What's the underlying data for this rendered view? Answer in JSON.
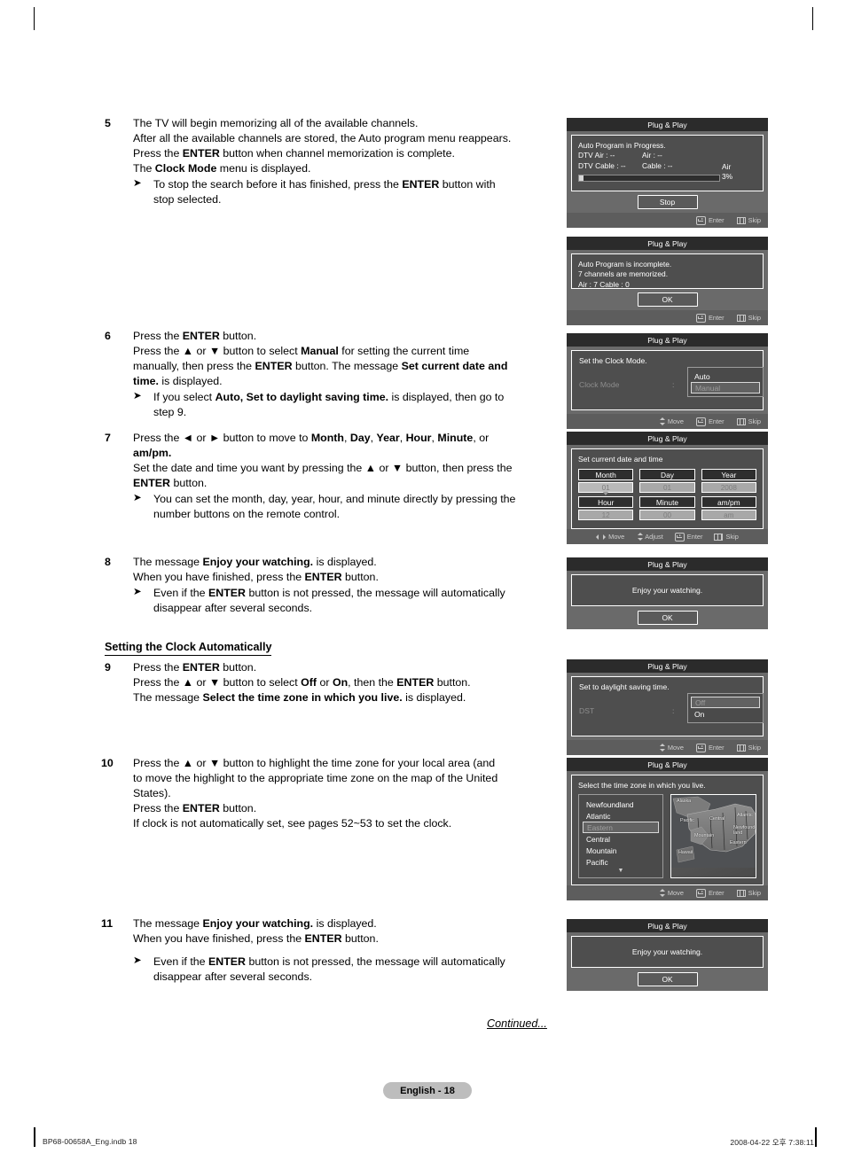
{
  "document": {
    "page_badge": "English - 18",
    "continued": "Continued...",
    "footer_left": "BP68-00658A_Eng.indb   18",
    "footer_right": "2008-04-22   오후 7:38:11"
  },
  "steps": [
    {
      "num": "5",
      "lines": [
        "The TV will begin memorizing all of the available channels.",
        "After all the available channels are stored, the Auto program menu reappears.",
        "Press the ENTER button when channel memorization is complete.",
        "The Clock Mode menu is displayed."
      ],
      "note": "To stop the search before it has finished, press the ENTER button with stop selected."
    },
    {
      "num": "6",
      "lines": [
        "Press the ENTER button.",
        "Press the ▲ or ▼ button to select Manual for setting the current time manually, then press the ENTER button. The message Set current date and time. is displayed."
      ],
      "note": "If you select Auto, Set to daylight saving time. is displayed, then go to step 9."
    },
    {
      "num": "7",
      "lines": [
        "Press the ◄ or ► button to move to Month, Day, Year, Hour, Minute, or am/pm.",
        "Set the date and time you want by pressing the ▲ or ▼ button, then press the ENTER button."
      ],
      "note": "You can set the month, day, year, hour, and minute directly by pressing the number buttons on the remote control."
    },
    {
      "num": "8",
      "lines": [
        "The message Enjoy your watching. is displayed.",
        "When you have finished, press the ENTER button."
      ],
      "note": "Even if the ENTER button is not pressed, the message will automatically disappear after several seconds."
    },
    {
      "num": "9",
      "heading": "Setting the Clock Automatically",
      "lines": [
        "Press the ENTER button.",
        "Press the ▲ or ▼ button to select Off or On, then the ENTER button.",
        "The message Select the time zone in which you live. is displayed."
      ]
    },
    {
      "num": "10",
      "lines": [
        "Press the ▲ or ▼ button to highlight the time zone for your local area (and to move the highlight to the appropriate time zone on the map of the United States).",
        "Press the ENTER button.",
        "If clock is not automatically set, see pages 52~53 to set the clock."
      ]
    },
    {
      "num": "11",
      "lines": [
        "The message Enjoy your watching. is displayed.",
        "When you have finished, press the ENTER button."
      ],
      "note": "Even if the ENTER button is not pressed, the message will automatically disappear after several seconds."
    }
  ],
  "osd": {
    "title": "Plug & Play",
    "footer": {
      "move": "Move",
      "adjust": "Adjust",
      "enter": "Enter",
      "skip": "Skip"
    },
    "panel_progress": {
      "heading": "Auto Program in Progress.",
      "row1_left": "DTV Air : --",
      "row1_right": "Air : --",
      "row2_left": "DTV Cable : --",
      "row2_right": "Cable : --",
      "band": "Air",
      "percent": "3%",
      "progress_value": 3,
      "button": "Stop"
    },
    "panel_incomplete": {
      "line1": "Auto Program is incomplete.",
      "line2": "7 channels are memorized.",
      "line3": "Air : 7     Cable : 0",
      "button": "OK"
    },
    "panel_clock_mode": {
      "heading": "Set the Clock Mode.",
      "label": "Clock Mode",
      "colon": ":",
      "options": [
        "Auto",
        "Manual"
      ],
      "selected": "Manual"
    },
    "panel_datetime": {
      "heading": "Set current date and time",
      "fields": [
        {
          "label": "Month",
          "value": "01",
          "active": true
        },
        {
          "label": "Day",
          "value": "01",
          "active": false
        },
        {
          "label": "Year",
          "value": "2008",
          "active": false
        },
        {
          "label": "Hour",
          "value": "12",
          "active": false
        },
        {
          "label": "Minute",
          "value": "00",
          "active": false
        },
        {
          "label": "am/pm",
          "value": "am",
          "active": false
        }
      ]
    },
    "panel_enjoy_1": {
      "message": "Enjoy your watching.",
      "button": "OK"
    },
    "panel_dst": {
      "heading": "Set to daylight saving time.",
      "label": "DST",
      "colon": ":",
      "options": [
        "Off",
        "On"
      ],
      "selected": "Off"
    },
    "panel_timezone": {
      "heading": "Select the time zone in which you live.",
      "items": [
        "Newfoundland",
        "Atlantic",
        "Eastern",
        "Central",
        "Mountain",
        "Pacific"
      ],
      "selected": "Eastern",
      "scroll_hint": "▼",
      "map_labels": [
        "Alaska",
        "Pacific",
        "Central",
        "Atlantic",
        "Newfound-land",
        "Mountain",
        "Eastern",
        "Hawaii"
      ]
    },
    "panel_enjoy_2": {
      "message": "Enjoy your watching.",
      "button": "OK"
    }
  }
}
